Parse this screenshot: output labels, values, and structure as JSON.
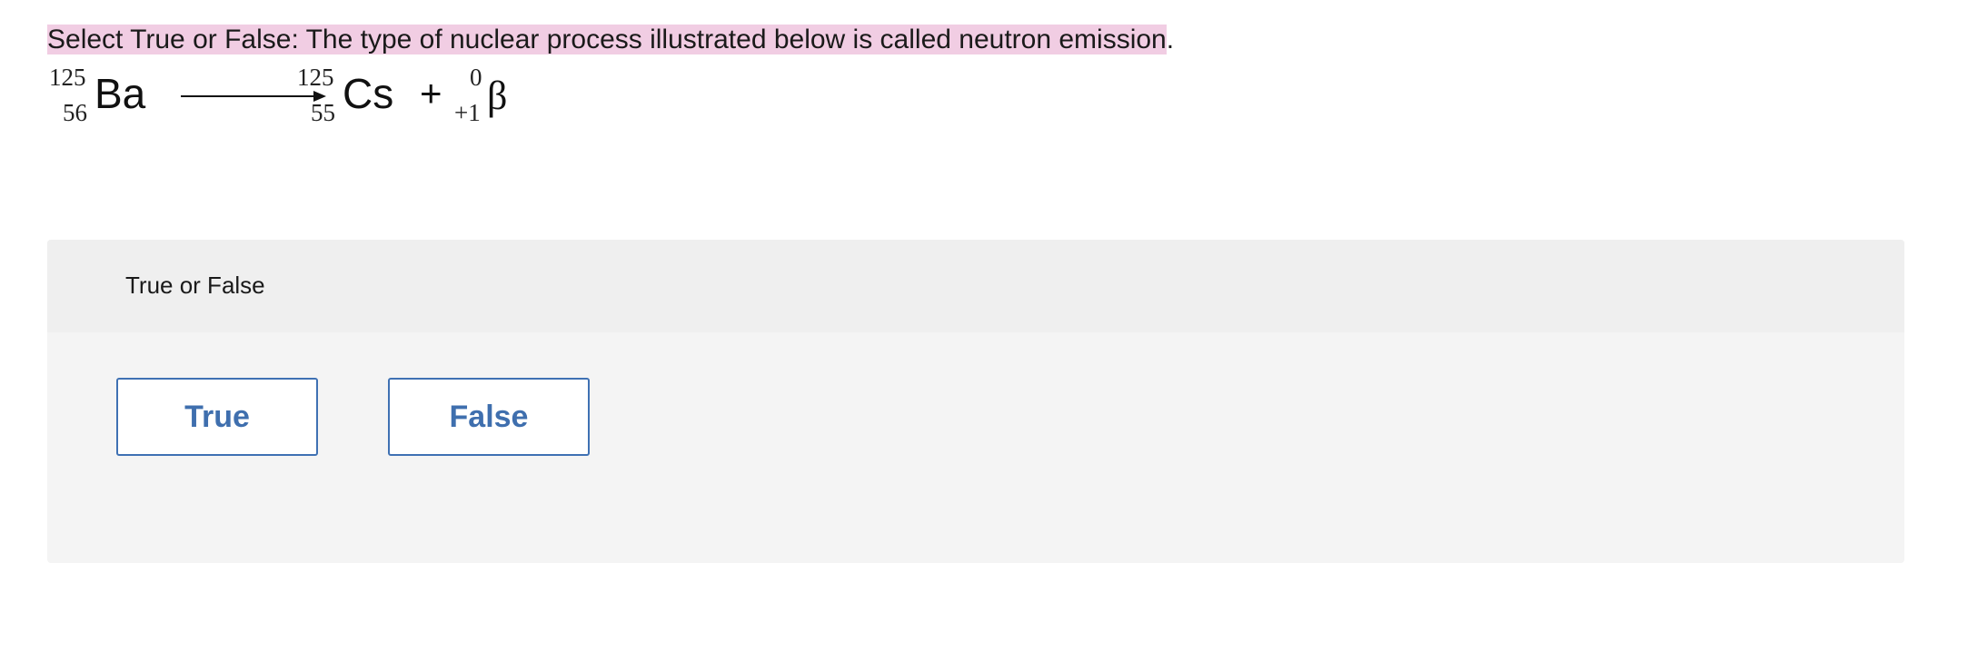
{
  "question": {
    "text": "Select True or False: The type of nuclear process illustrated below is called neutron emission",
    "end_punct": ".",
    "highlight_color": "#f1cde3"
  },
  "equation": {
    "reactant": {
      "mass": "125",
      "atomic": "56",
      "symbol": "Ba"
    },
    "arrow": "→",
    "product1": {
      "mass": "125",
      "atomic": "55",
      "symbol": "Cs"
    },
    "plus": "+",
    "product2": {
      "mass": "0",
      "atomic": "+1",
      "symbol": "β"
    }
  },
  "panel": {
    "header": "True or False",
    "buttons": {
      "true_label": "True",
      "false_label": "False"
    },
    "accent_color": "#3f6fae"
  }
}
